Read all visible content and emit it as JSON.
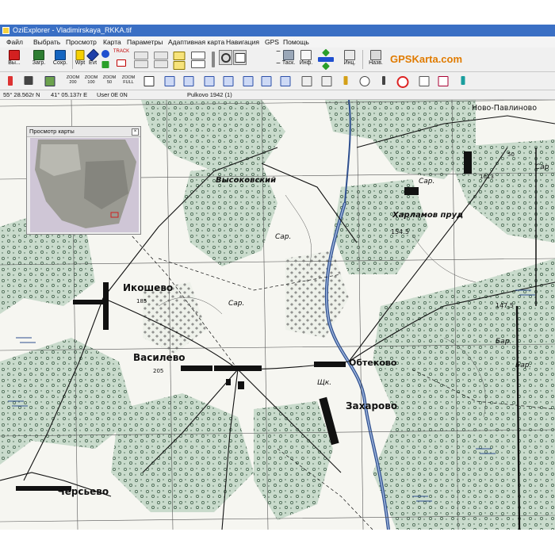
{
  "window": {
    "title": "OziExplorer - Vladimirskaya_RKKA.tif"
  },
  "menu": [
    "Файл",
    "Выбрать",
    "Просмотр",
    "Карта",
    "Параметры",
    "Адаптивная карта",
    "Навигация",
    "GPS",
    "Помощь"
  ],
  "toolbar1": {
    "exit_label": "Вы...",
    "load_label": "Загр.",
    "save_label": "Сохр.",
    "wpt_label": "Wpt",
    "evt_label": "Evt",
    "track_label": "TRACK",
    "zoom_value": "90",
    "task_label": "Таск.",
    "info_label": "Инф.",
    "inc_label": "Инц.",
    "name_label": "Назв.",
    "brand": "GPSKarta.com"
  },
  "toolbar2": {
    "zoom_buttons": [
      "ZOOM\n200",
      "ZOOM\n100",
      "ZOOM\n50",
      "ZOOM\nFULL"
    ]
  },
  "statusbar": {
    "latitude": "55° 28.562г N",
    "longitude": "41° 05.137г E",
    "user": "User 0E  0N",
    "datum": "Pulkovo 1942 (1)"
  },
  "preview": {
    "title": "Просмотр карты"
  },
  "map": {
    "labels": {
      "novo_pavlino": "Ново-Павлиново",
      "visokovsky": "Высоковский",
      "sar1": "Сар.",
      "kharlamov": "Харламов пруд",
      "elev_1545": "154.5",
      "elev_1613": "1613",
      "elev_50a": "50",
      "ikoshevo": "Икошево",
      "elev_185": "185",
      "sar2": "Сар.",
      "sar3": "Сар.",
      "vasilevo": "Василево",
      "elev_205": "205",
      "obtekovo": "Обтеково",
      "shk": "Щк.",
      "zakharovo": "Захарово",
      "chersevo": "Черсьево",
      "elev_1475": "147,5",
      "bar1": "Бар.",
      "bar2": "Бар.",
      "sar_right": "Сар"
    }
  }
}
